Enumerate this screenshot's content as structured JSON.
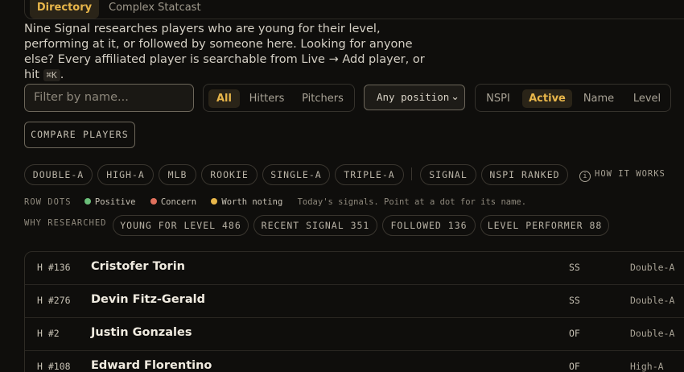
{
  "tabs": {
    "active": "Directory",
    "other": "Complex Statcast"
  },
  "intro": {
    "text": "Nine Signal researches players who are young for their level, performing at it, or followed by someone here. Looking for anyone else? Every affiliated player is searchable from Live → Add player, or hit",
    "shortcut": "⌘K",
    "end": "."
  },
  "filter": {
    "placeholder": "Filter by name..."
  },
  "type_toggle": [
    "All",
    "Hitters",
    "Pitchers"
  ],
  "position_select": {
    "selected": "Any position"
  },
  "sort_toggle": [
    "NSPI",
    "Active",
    "Name",
    "Level"
  ],
  "compare_label": "COMPARE PLAYERS",
  "level_chips": [
    "DOUBLE-A",
    "HIGH-A",
    "MLB",
    "ROOKIE",
    "SINGLE-A",
    "TRIPLE-A"
  ],
  "signal_chips": [
    "SIGNAL",
    "NSPI RANKED"
  ],
  "how_it_works": "HOW IT WORKS",
  "legend": {
    "key": "ROW DOTS",
    "items": [
      {
        "label": "Positive",
        "color": "#6bbf7a"
      },
      {
        "label": "Concern",
        "color": "#e0705c"
      },
      {
        "label": "Worth noting",
        "color": "#e8b64a"
      }
    ],
    "note": "Today's signals. Point at a dot for its name."
  },
  "why": {
    "label": "WHY RESEARCHED",
    "chips": [
      "YOUNG FOR LEVEL 486",
      "RECENT SIGNAL 351",
      "FOLLOWED 136",
      "LEVEL PERFORMER 88"
    ]
  },
  "players": [
    {
      "num": "H #136",
      "name": "Cristofer Torin",
      "pos": "SS",
      "level": "Double-A"
    },
    {
      "num": "H #276",
      "name": "Devin Fitz-Gerald",
      "pos": "SS",
      "level": "Double-A"
    },
    {
      "num": "H #2",
      "name": "Justin Gonzales",
      "pos": "OF",
      "level": "Double-A"
    },
    {
      "num": "H #108",
      "name": "Edward Florentino",
      "pos": "OF",
      "level": "High-A"
    }
  ]
}
